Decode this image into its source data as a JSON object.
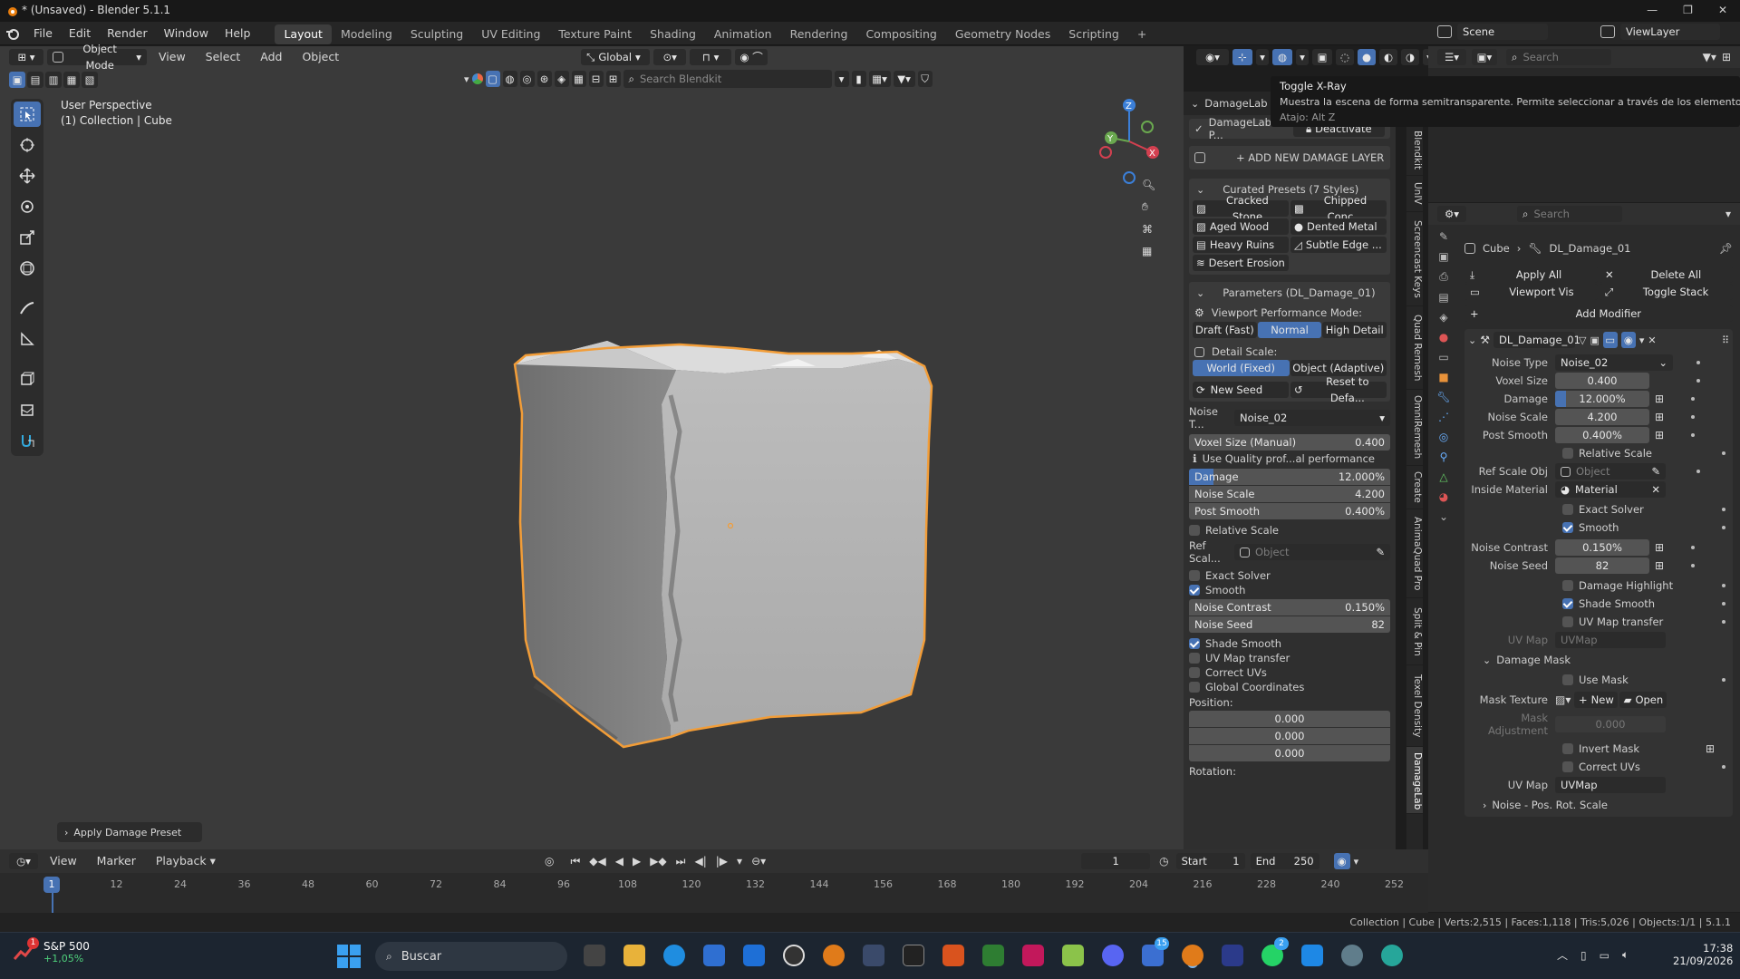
{
  "window": {
    "title": "* (Unsaved) - Blender 5.1.1"
  },
  "menu": {
    "items": [
      "File",
      "Edit",
      "Render",
      "Window",
      "Help"
    ]
  },
  "workspaces": [
    "Layout",
    "Modeling",
    "Sculpting",
    "UV Editing",
    "Texture Paint",
    "Shading",
    "Animation",
    "Rendering",
    "Compositing",
    "Geometry Nodes",
    "Scripting"
  ],
  "active_workspace": "Layout",
  "scene": {
    "name": "Scene",
    "view_layer": "ViewLayer"
  },
  "search_placeholder": "Search",
  "viewport_header": {
    "mode": "Object Mode",
    "view": "View",
    "select": "Select",
    "add": "Add",
    "object": "Object",
    "orientation": "Global",
    "blendkit_search": "Search Blendkit"
  },
  "viewport": {
    "title": "User Perspective",
    "subtitle": "(1) Collection | Cube",
    "last_op": "Apply Damage Preset"
  },
  "tooltip": {
    "title": "Toggle X-Ray",
    "desc": "Muestra la escena de forma semitransparente. Permite seleccionar a través de los elementos.",
    "shortcut": "Atajo: Alt Z"
  },
  "npanel": {
    "header": "DamageLab",
    "addon_label": "DamageLab P...",
    "deactivate": "Deactivate",
    "add_layer": "+ ADD NEW DAMAGE LAYER",
    "presets_title": "Curated Presets (7 Styles)",
    "presets": [
      "Cracked Stone",
      "Chipped Conc...",
      "Aged Wood",
      "Dented Metal",
      "Heavy Ruins",
      "Subtle Edge ...",
      "Desert Erosion"
    ],
    "params_title": "Parameters (DL_Damage_01)",
    "perf_label": "Viewport Performance Mode:",
    "perf_modes": [
      "Draft (Fast)",
      "Normal",
      "High Detail"
    ],
    "detail_label": "Detail Scale:",
    "detail_modes": [
      "World (Fixed)",
      "Object (Adaptive)"
    ],
    "new_seed": "New Seed",
    "reset": "Reset to Defa...",
    "noise_type_label": "Noise T...",
    "noise_type": "Noise_02",
    "voxel_label": "Voxel Size (Manual)",
    "voxel": "0.400",
    "quality_note": "Use Quality prof...al performance",
    "damage_label": "Damage",
    "damage": "12.000%",
    "damage_fraction": 0.12,
    "noise_scale_label": "Noise Scale",
    "noise_scale": "4.200",
    "post_smooth_label": "Post Smooth",
    "post_smooth": "0.400%",
    "relative_scale": "Relative Scale",
    "ref_scale_label": "Ref Scal...",
    "ref_placeholder": "Object",
    "exact_solver": "Exact Solver",
    "smooth": "Smooth",
    "noise_contrast_label": "Noise Contrast",
    "noise_contrast": "0.150%",
    "noise_seed_label": "Noise Seed",
    "noise_seed": "82",
    "shade_smooth": "Shade Smooth",
    "uv_transfer": "UV Map transfer",
    "correct_uvs": "Correct UVs",
    "global_coords": "Global Coordinates",
    "position_label": "Position:",
    "position": [
      "0.000",
      "0.000",
      "0.000"
    ],
    "rotation_label": "Rotation:"
  },
  "side_tabs": [
    "Blendkit",
    "UnIV",
    "Screencast Keys",
    "Quad Remesh",
    "OmniRemesh",
    "Create",
    "AnimaQuad Pro",
    "Split & Pin",
    "Texel Density",
    "DamageLab"
  ],
  "properties": {
    "breadcrumb_object": "Cube",
    "breadcrumb_modifier": "DL_Damage_01",
    "apply_all": "Apply All",
    "delete_all": "Delete All",
    "viewport_vis": "Viewport Vis",
    "toggle_stack": "Toggle Stack",
    "add_modifier": "Add Modifier",
    "modifier_name": "DL_Damage_01",
    "noise_type_label": "Noise Type",
    "noise_type": "Noise_02",
    "voxel_label": "Voxel Size",
    "voxel": "0.400",
    "damage_label": "Damage",
    "damage": "12.000%",
    "damage_fraction": 0.12,
    "noise_scale_label": "Noise Scale",
    "noise_scale": "4.200",
    "post_smooth_label": "Post Smooth",
    "post_smooth": "0.400%",
    "relative_scale": "Relative Scale",
    "ref_scale_label": "Ref Scale Obj",
    "ref_placeholder": "Object",
    "inside_mat_label": "Inside Material",
    "inside_mat": "Material",
    "exact_solver": "Exact Solver",
    "smooth": "Smooth",
    "noise_contrast_label": "Noise Contrast",
    "noise_contrast": "0.150%",
    "noise_seed_label": "Noise Seed",
    "noise_seed": "82",
    "damage_highlight": "Damage Highlight",
    "shade_smooth": "Shade Smooth",
    "uv_transfer": "UV Map transfer",
    "uvmap_label": "UV Map",
    "uvmap_placeholder": "UVMap",
    "mask_title": "Damage Mask",
    "use_mask": "Use Mask",
    "mask_tex_label": "Mask Texture",
    "mask_new": "New",
    "mask_open": "Open",
    "mask_adj_label": "Mask Adjustment",
    "mask_adj": "0.000",
    "invert_mask": "Invert Mask",
    "correct_uvs": "Correct UVs",
    "uvmap2_label": "UV Map",
    "uvmap2": "UVMap",
    "sub_panel": "Noise - Pos. Rot. Scale"
  },
  "timeline": {
    "view": "View",
    "marker": "Marker",
    "playback": "Playback",
    "frame": "1",
    "start_label": "Start",
    "start": "1",
    "end_label": "End",
    "end": "250",
    "ticks": [
      "1",
      "12",
      "24",
      "36",
      "48",
      "60",
      "72",
      "84",
      "96",
      "108",
      "120",
      "132",
      "144",
      "156",
      "168",
      "180",
      "192",
      "204",
      "216",
      "228",
      "240",
      "252"
    ]
  },
  "statusbar": {
    "text": "Collection | Cube | Verts:2,515 | Faces:1,118 | Tris:5,026 | Objects:1/1 | 5.1.1"
  },
  "taskbar": {
    "stock_name": "S&P 500",
    "stock_change": "+1,05%",
    "search": "Buscar",
    "time": "17:38",
    "date": "21/09/2026",
    "badge1": "15",
    "badge2": "2",
    "stock_badge": "1"
  },
  "colors": {
    "accent": "#4772b3",
    "outline": "#f29d38",
    "bg": "#393939"
  }
}
